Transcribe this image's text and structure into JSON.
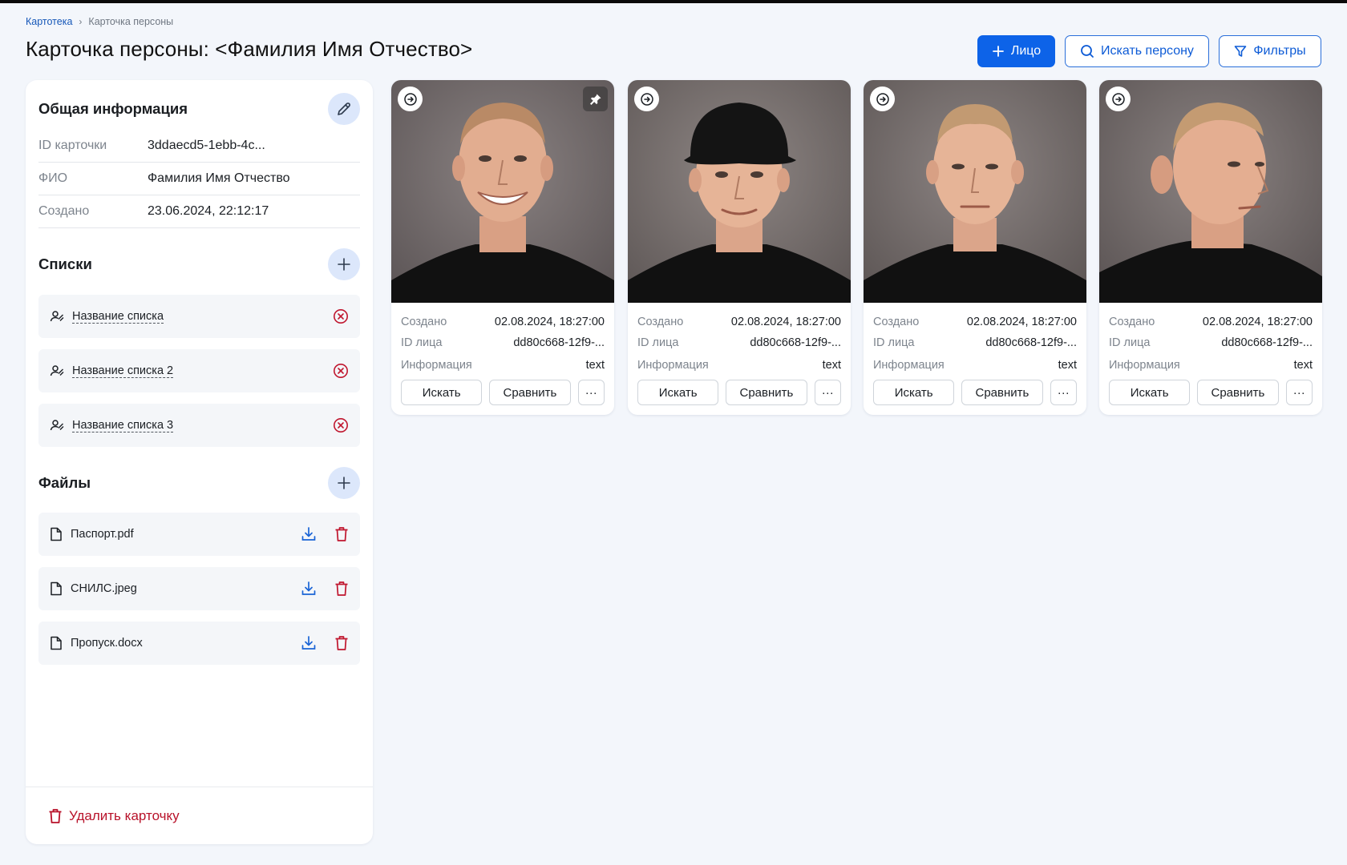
{
  "breadcrumb": {
    "root": "Картотека",
    "current": "Карточка персоны"
  },
  "page_title": "Карточка персоны: <Фамилия Имя Отчество>",
  "actions": {
    "add_face": "Лицо",
    "search_person": "Искать персону",
    "filters": "Фильтры"
  },
  "general": {
    "title": "Общая информация",
    "rows": [
      {
        "key": "ID карточки",
        "value": "3ddaecd5-1ebb-4c..."
      },
      {
        "key": "ФИО",
        "value": "Фамилия Имя Отчество"
      },
      {
        "key": "Создано",
        "value": "23.06.2024, 22:12:17"
      }
    ]
  },
  "lists": {
    "title": "Списки",
    "items": [
      {
        "label": "Название списка"
      },
      {
        "label": "Название списка 2"
      },
      {
        "label": "Название списка 3"
      }
    ]
  },
  "files": {
    "title": "Файлы",
    "items": [
      {
        "label": "Паспорт.pdf"
      },
      {
        "label": "СНИЛС.jpeg"
      },
      {
        "label": "Пропуск.docx"
      }
    ]
  },
  "delete_label": "Удалить карточку",
  "card_labels": {
    "created": "Создано",
    "face_id": "ID лица",
    "info": "Информация",
    "search": "Искать",
    "compare": "Сравнить",
    "more": "···"
  },
  "cards": [
    {
      "created": "02.08.2024, 18:27:00",
      "face_id": "dd80c668-12f9-...",
      "info": "text"
    },
    {
      "created": "02.08.2024, 18:27:00",
      "face_id": "dd80c668-12f9-...",
      "info": "text"
    },
    {
      "created": "02.08.2024, 18:27:00",
      "face_id": "dd80c668-12f9-...",
      "info": "text"
    },
    {
      "created": "02.08.2024, 18:27:00",
      "face_id": "dd80c668-12f9-...",
      "info": "text"
    }
  ],
  "colors": {
    "primary": "#0d63e8",
    "danger": "#b8122a",
    "background": "#f3f6fb"
  }
}
